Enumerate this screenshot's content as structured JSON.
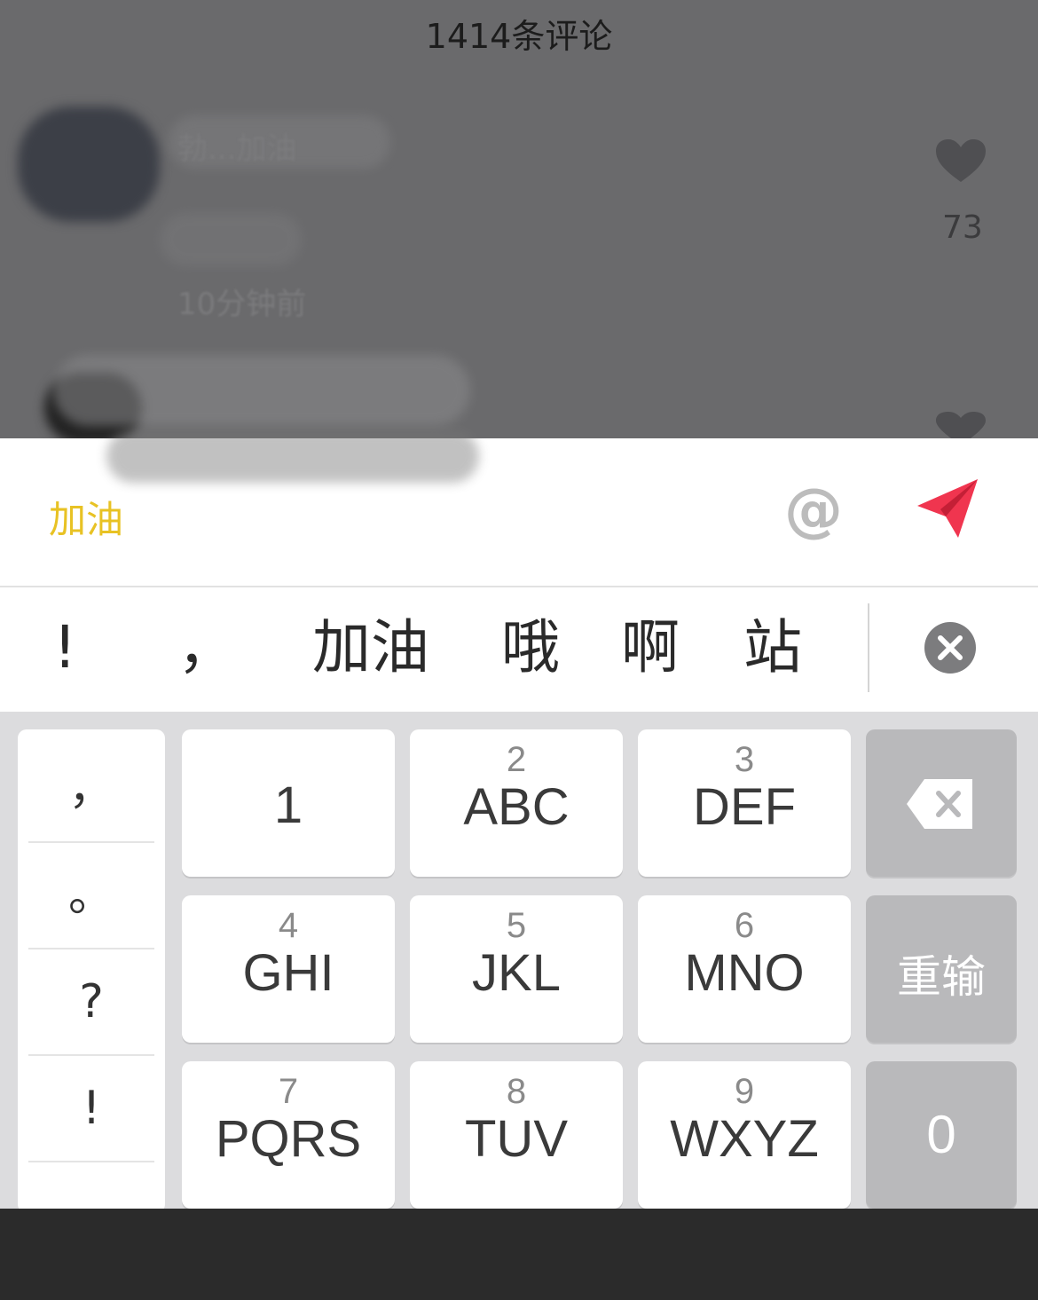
{
  "comments_sheet": {
    "title": "1414条评论",
    "comment_1": {
      "obscured_text": "勃...加油",
      "time": "10分钟前",
      "like_count": "73"
    }
  },
  "input_bar": {
    "text": "加油",
    "at_label": "@",
    "send_icon": "paper-plane-icon"
  },
  "candidates": {
    "items": [
      "!",
      "，",
      "加油",
      "哦",
      "啊",
      "站"
    ],
    "clear_icon": "clear-circle-icon"
  },
  "keyboard": {
    "punctuation": [
      "，",
      "。",
      "?",
      "!"
    ],
    "keys": [
      {
        "num": "",
        "letters": "1"
      },
      {
        "num": "2",
        "letters": "ABC"
      },
      {
        "num": "3",
        "letters": "DEF"
      },
      {
        "num": "4",
        "letters": "GHI"
      },
      {
        "num": "5",
        "letters": "JKL"
      },
      {
        "num": "6",
        "letters": "MNO"
      },
      {
        "num": "7",
        "letters": "PQRS"
      },
      {
        "num": "8",
        "letters": "TUV"
      },
      {
        "num": "9",
        "letters": "WXYZ"
      }
    ],
    "backspace_icon": "backspace-icon",
    "reenter_label": "重输",
    "zero_label": "0"
  },
  "colors": {
    "accent_text": "#e8c224",
    "send_red": "#f0354f",
    "dim_overlay": "#6a6a6c"
  }
}
